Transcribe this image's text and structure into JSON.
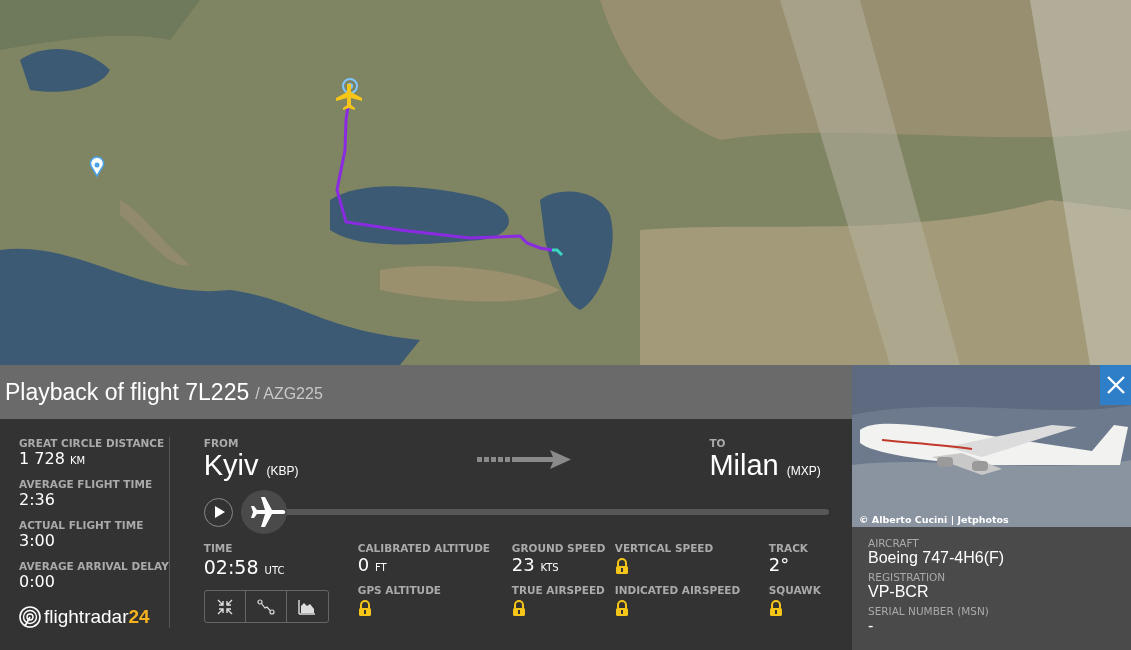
{
  "header": {
    "title": "Playback of flight 7L225",
    "callsign": "/ AZG225"
  },
  "stats": [
    {
      "label": "GREAT CIRCLE DISTANCE",
      "value": "1 728",
      "unit": "KM"
    },
    {
      "label": "AVERAGE FLIGHT TIME",
      "value": "2:36"
    },
    {
      "label": "ACTUAL FLIGHT TIME",
      "value": "3:00"
    },
    {
      "label": "AVERAGE ARRIVAL DELAY",
      "value": "0:00"
    }
  ],
  "logo": {
    "text": "flightradar",
    "accent": "24"
  },
  "route": {
    "from_label": "FROM",
    "from_city": "Kyiv",
    "from_code": "(KBP)",
    "to_label": "TO",
    "to_city": "Milan",
    "to_code": "(MXP)"
  },
  "playback": {
    "playing": false,
    "level": 0
  },
  "time": {
    "label": "TIME",
    "value": "02:58",
    "unit": "UTC"
  },
  "metrics": [
    {
      "label": "CALIBRATED ALTITUDE",
      "value": "0",
      "unit": "FT",
      "locked": false
    },
    {
      "label": "GROUND SPEED",
      "value": "23",
      "unit": "KTS",
      "locked": false
    },
    {
      "label": "VERTICAL SPEED",
      "locked": true
    },
    {
      "label": "TRACK",
      "value": "2°",
      "locked": false
    },
    {
      "label": "GPS ALTITUDE",
      "locked": true
    },
    {
      "label": "TRUE AIRSPEED",
      "locked": true
    },
    {
      "label": "INDICATED AIRSPEED",
      "locked": true
    },
    {
      "label": "SQUAWK",
      "locked": true
    }
  ],
  "view_buttons": [
    {
      "kind": "collapse"
    },
    {
      "kind": "route"
    },
    {
      "kind": "graph"
    }
  ],
  "photo": {
    "kind": "picture",
    "credit": "© Alberto Cucini | Jetphotos"
  },
  "aircraft": [
    {
      "label": "AIRCRAFT",
      "value": "Boeing 747-4H6(F)"
    },
    {
      "label": "REGISTRATION",
      "value": "VP-BCR"
    },
    {
      "label": "SERIAL NUMBER (MSN)",
      "value": "-"
    }
  ]
}
